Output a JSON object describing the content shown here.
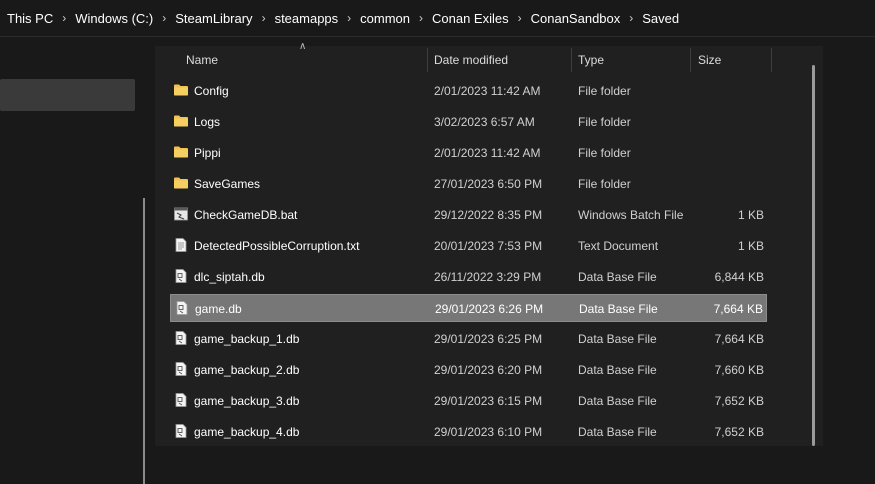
{
  "breadcrumb": [
    "This PC",
    "Windows (C:)",
    "SteamLibrary",
    "steamapps",
    "common",
    "Conan Exiles",
    "ConanSandbox",
    "Saved"
  ],
  "columns": {
    "name": "Name",
    "date": "Date modified",
    "type": "Type",
    "size": "Size"
  },
  "files": [
    {
      "name": "Config",
      "date": "2/01/2023 11:42 AM",
      "type": "File folder",
      "size": "",
      "icon": "folder-icon"
    },
    {
      "name": "Logs",
      "date": "3/02/2023 6:57 AM",
      "type": "File folder",
      "size": "",
      "icon": "folder-icon"
    },
    {
      "name": "Pippi",
      "date": "2/01/2023 11:42 AM",
      "type": "File folder",
      "size": "",
      "icon": "folder-icon"
    },
    {
      "name": "SaveGames",
      "date": "27/01/2023 6:50 PM",
      "type": "File folder",
      "size": "",
      "icon": "folder-icon"
    },
    {
      "name": "CheckGameDB.bat",
      "date": "29/12/2022 8:35 PM",
      "type": "Windows Batch File",
      "size": "1 KB",
      "icon": "batch-file-icon"
    },
    {
      "name": "DetectedPossibleCorruption.txt",
      "date": "20/01/2023 7:53 PM",
      "type": "Text Document",
      "size": "1 KB",
      "icon": "text-file-icon"
    },
    {
      "name": "dlc_siptah.db",
      "date": "26/11/2022 3:29 PM",
      "type": "Data Base File",
      "size": "6,844 KB",
      "icon": "db-file-icon"
    },
    {
      "name": "game.db",
      "date": "29/01/2023 6:26 PM",
      "type": "Data Base File",
      "size": "7,664 KB",
      "icon": "db-file-icon",
      "selected": true
    },
    {
      "name": "game_backup_1.db",
      "date": "29/01/2023 6:25 PM",
      "type": "Data Base File",
      "size": "7,664 KB",
      "icon": "db-file-icon"
    },
    {
      "name": "game_backup_2.db",
      "date": "29/01/2023 6:20 PM",
      "type": "Data Base File",
      "size": "7,660 KB",
      "icon": "db-file-icon"
    },
    {
      "name": "game_backup_3.db",
      "date": "29/01/2023 6:15 PM",
      "type": "Data Base File",
      "size": "7,652 KB",
      "icon": "db-file-icon"
    },
    {
      "name": "game_backup_4.db",
      "date": "29/01/2023 6:10 PM",
      "type": "Data Base File",
      "size": "7,652 KB",
      "icon": "db-file-icon"
    }
  ],
  "colors": {
    "folder": "#f2c14e",
    "selected_row": "#777777",
    "background": "#191919",
    "content_bg": "#202020"
  }
}
